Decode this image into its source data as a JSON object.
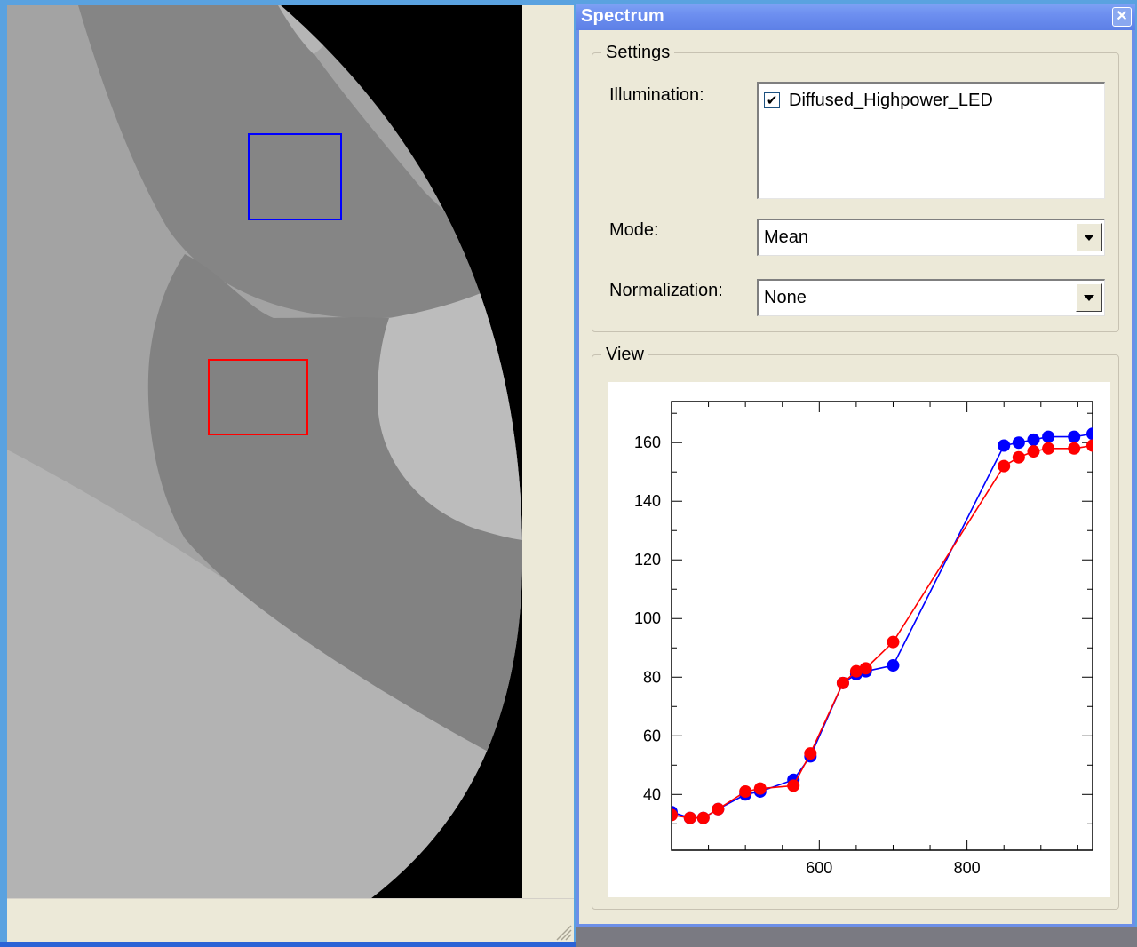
{
  "spectrum_panel": {
    "title": "Spectrum",
    "close_label": "✕",
    "settings": {
      "legend": "Settings",
      "illumination_label": "Illumination:",
      "illumination_items": [
        {
          "label": "Diffused_Highpower_LED",
          "checked": true,
          "check_glyph": "✔"
        }
      ],
      "mode_label": "Mode:",
      "mode_value": "Mean",
      "normalization_label": "Normalization:",
      "normalization_value": "None"
    },
    "view": {
      "legend": "View"
    }
  },
  "image_view": {
    "rois": [
      {
        "color": "#0000ff"
      },
      {
        "color": "#ff0000"
      }
    ]
  },
  "chart_data": {
    "type": "line",
    "xlim": [
      400,
      970
    ],
    "ylim": [
      21,
      174
    ],
    "x_ticks": [
      600,
      800
    ],
    "y_ticks": [
      40,
      60,
      80,
      100,
      120,
      140,
      160
    ],
    "grid": false,
    "legend": "none",
    "series": [
      {
        "color": "#0000ff",
        "points": [
          [
            400,
            34
          ],
          [
            425,
            32
          ],
          [
            443,
            32
          ],
          [
            463,
            35
          ],
          [
            500,
            40
          ],
          [
            520,
            41
          ],
          [
            565,
            45
          ],
          [
            588,
            53
          ],
          [
            632,
            78
          ],
          [
            650,
            81
          ],
          [
            663,
            82
          ],
          [
            700,
            84
          ],
          [
            850,
            159
          ],
          [
            870,
            160
          ],
          [
            890,
            161
          ],
          [
            910,
            162
          ],
          [
            945,
            162
          ],
          [
            970,
            163
          ]
        ]
      },
      {
        "color": "#ff0000",
        "points": [
          [
            400,
            33
          ],
          [
            425,
            32
          ],
          [
            443,
            32
          ],
          [
            463,
            35
          ],
          [
            500,
            41
          ],
          [
            520,
            42
          ],
          [
            565,
            43
          ],
          [
            588,
            54
          ],
          [
            632,
            78
          ],
          [
            650,
            82
          ],
          [
            663,
            83
          ],
          [
            700,
            92
          ],
          [
            850,
            152
          ],
          [
            870,
            155
          ],
          [
            890,
            157
          ],
          [
            910,
            158
          ],
          [
            945,
            158
          ],
          [
            970,
            159
          ]
        ]
      }
    ]
  }
}
